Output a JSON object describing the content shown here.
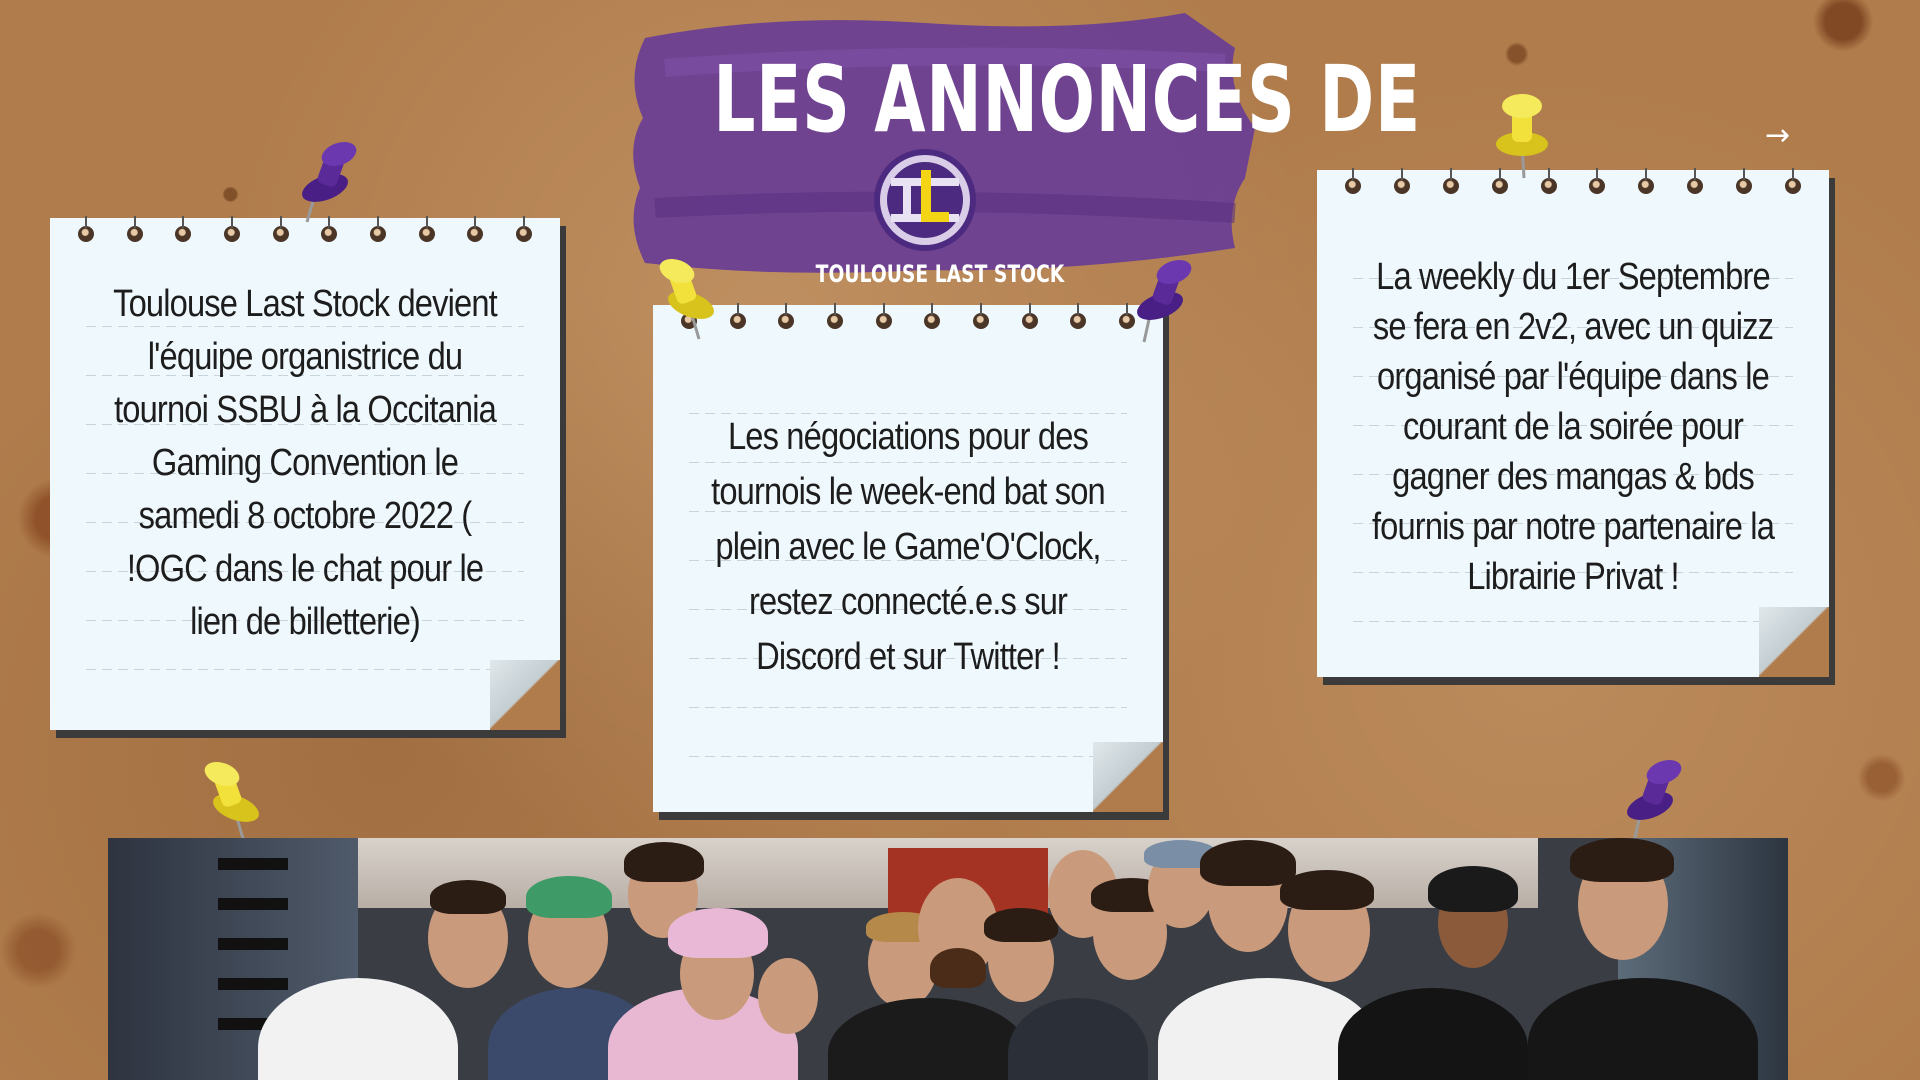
{
  "banner": {
    "title": "LES ANNONCES DE",
    "logo_text": "TOULOUSE LAST STOCK",
    "colors": {
      "brush": "#6b3f94",
      "text": "#ffffff",
      "logo_yellow": "#f4d516"
    }
  },
  "nav": {
    "next_icon": "→"
  },
  "notes": [
    {
      "text": "Toulouse Last Stock devient l'équipe organistrice du tournoi SSBU à la Occitania Gaming Convention le samedi 8 octobre 2022 ( !OGC dans le chat pour le lien de billetterie)"
    },
    {
      "text": "Les négociations pour des tournois le week-end bat son plein avec le Game'O'Clock, restez connecté.e.s sur Discord et sur Twitter !"
    },
    {
      "text": "La weekly du 1er Septembre se fera en 2v2, avec un quizz organisé par l'équipe dans le courant de la soirée pour gagner des mangas & bds fournis par notre partenaire la Librairie Privat !"
    }
  ],
  "pins": {
    "purple": "#5a2a98",
    "yellow": "#f1e13a"
  }
}
